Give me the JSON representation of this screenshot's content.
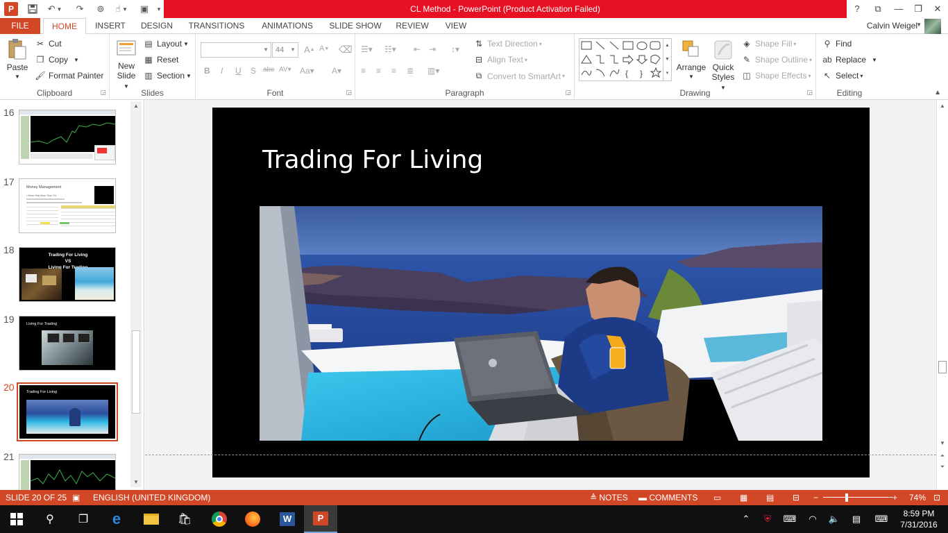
{
  "app": {
    "title": "CL Method -  PowerPoint (Product Activation Failed)",
    "logo_letter": "P",
    "help": "?",
    "user_name": "Calvin Weigel"
  },
  "tabs": [
    "FILE",
    "HOME",
    "INSERT",
    "DESIGN",
    "TRANSITIONS",
    "ANIMATIONS",
    "SLIDE SHOW",
    "REVIEW",
    "VIEW"
  ],
  "active_tab": "HOME",
  "ribbon": {
    "clipboard": {
      "label": "Clipboard",
      "paste": "Paste",
      "cut": "Cut",
      "copy": "Copy",
      "format_painter": "Format Painter"
    },
    "slides": {
      "label": "Slides",
      "new_slide_line1": "New",
      "new_slide_line2": "Slide",
      "layout": "Layout",
      "reset": "Reset",
      "section": "Section"
    },
    "font": {
      "label": "Font",
      "font_name": "",
      "font_size": "44"
    },
    "paragraph": {
      "label": "Paragraph",
      "text_direction": "Text Direction",
      "align_text": "Align Text",
      "convert_smartart": "Convert to SmartArt"
    },
    "drawing": {
      "label": "Drawing",
      "arrange": "Arrange",
      "quick_styles_line1": "Quick",
      "quick_styles_line2": "Styles",
      "shape_fill": "Shape Fill",
      "shape_outline": "Shape Outline",
      "shape_effects": "Shape Effects"
    },
    "editing": {
      "label": "Editing",
      "find": "Find",
      "replace": "Replace",
      "select": "Select"
    }
  },
  "thumbnails": [
    {
      "num": "16",
      "title": ""
    },
    {
      "num": "17",
      "title": "Money Management"
    },
    {
      "num": "18",
      "title": "Trading For Living\nVS\nLiving For Trading"
    },
    {
      "num": "19",
      "title": "Living For Trading"
    },
    {
      "num": "20",
      "title": "Trading For Living"
    },
    {
      "num": "21",
      "title": ""
    }
  ],
  "thumb_texts": {
    "t17_b1": "• Never Risk More Than 3%",
    "t18_line1": "Trading For Living",
    "t18_line2": "VS",
    "t18_line3": "Living For Trading"
  },
  "selected_slide": "20",
  "slide": {
    "title": "Trading For Living"
  },
  "status": {
    "slide_info": "SLIDE 20 OF 25",
    "language": "ENGLISH (UNITED KINGDOM)",
    "notes": "NOTES",
    "comments": "COMMENTS",
    "zoom": "74%"
  },
  "taskbar": {
    "time": "8:59 PM",
    "date": "7/31/2016"
  },
  "colors": {
    "accent": "#d24726",
    "titlebar_red": "#e81123"
  }
}
